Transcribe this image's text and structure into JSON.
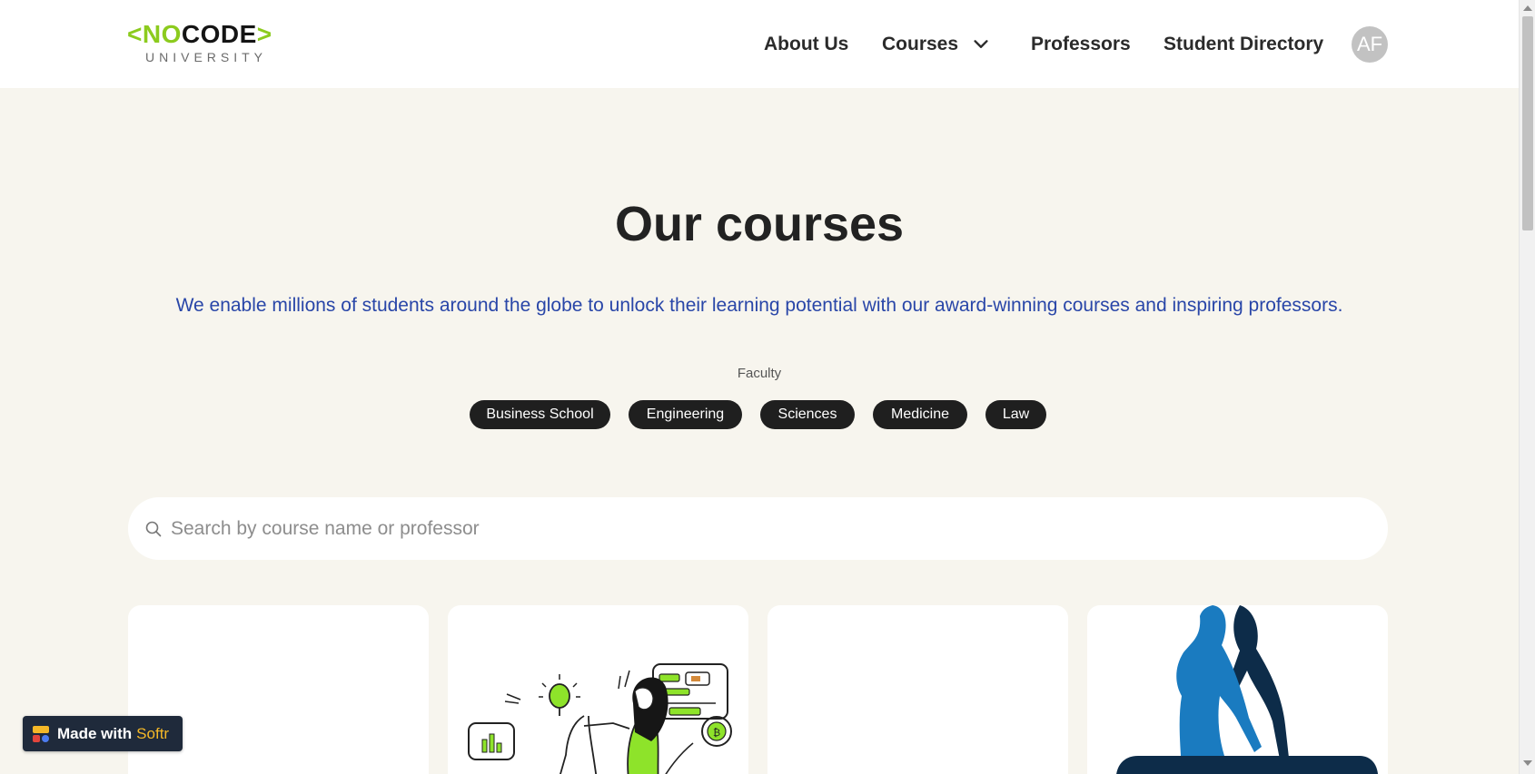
{
  "header": {
    "logo": {
      "bracket_left": "<",
      "no": "NO",
      "code": "CODE",
      "bracket_right": ">",
      "subtitle": "UNIVERSITY"
    },
    "nav": [
      {
        "label": "About Us"
      },
      {
        "label": "Courses",
        "has_dropdown": true
      },
      {
        "label": "Professors"
      },
      {
        "label": "Student Directory"
      }
    ],
    "avatar_initials": "AF"
  },
  "hero": {
    "title": "Our courses",
    "subtitle": "We enable millions of students around the globe to unlock their learning potential with our award-winning courses and inspiring professors."
  },
  "filters": {
    "label": "Faculty",
    "chips": [
      "Business School",
      "Engineering",
      "Sciences",
      "Medicine",
      "Law"
    ]
  },
  "search": {
    "placeholder": "Search by course name or professor",
    "value": ""
  },
  "cards": [
    {
      "image": "blank"
    },
    {
      "image": "illustration-person-ideas"
    },
    {
      "image": "blank"
    },
    {
      "image": "dance-logo"
    }
  ],
  "badge": {
    "text": "Made with",
    "brand": "Softr"
  },
  "colors": {
    "accent_green": "#8ccb1e",
    "subtitle_blue": "#2946a8",
    "chip_bg": "#1f1f1f",
    "page_bg": "#f7f5ee",
    "dance_blue": "#1a7bc0",
    "dance_navy": "#0d2c49",
    "softr_yellow": "#f5b827"
  }
}
